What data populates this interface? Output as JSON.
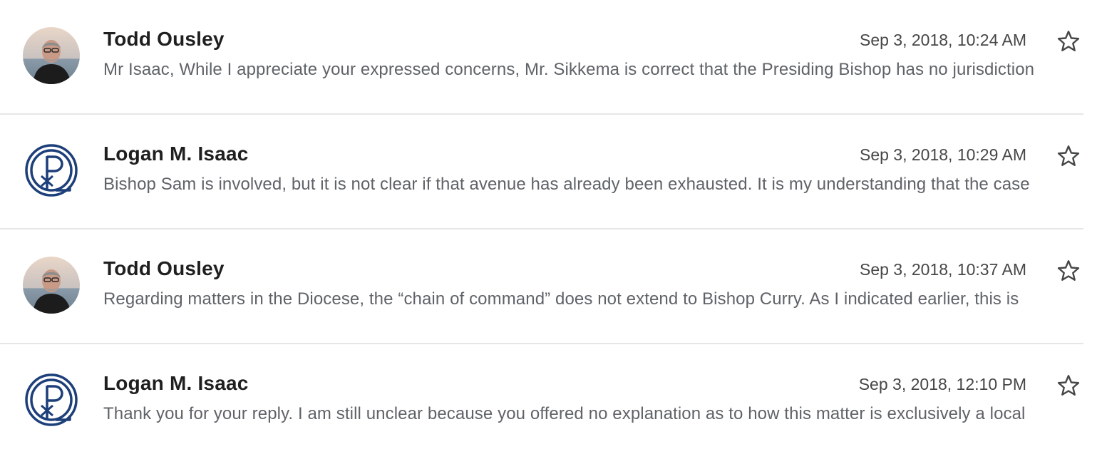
{
  "messages": [
    {
      "sender": "Todd Ousley",
      "avatar": "photo",
      "date": "Sep 3, 2018, 10:24 AM",
      "snippet": "Mr Isaac, While I appreciate your expressed concerns, Mr. Sikkema is correct that the Presiding Bishop has no jurisdiction",
      "starred": false
    },
    {
      "sender": "Logan M. Isaac",
      "avatar": "chi-rho-logo",
      "date": "Sep 3, 2018, 10:29 AM",
      "snippet": "Bishop Sam is involved, but it is not clear if that avenue has already been exhausted. It is my understanding that the case",
      "starred": false
    },
    {
      "sender": "Todd Ousley",
      "avatar": "photo",
      "date": "Sep 3, 2018, 10:37 AM",
      "snippet": "Regarding matters in the Diocese, the “chain of command” does not extend to Bishop Curry. As I indicated earlier, this is",
      "starred": false
    },
    {
      "sender": "Logan M. Isaac",
      "avatar": "chi-rho-logo",
      "date": "Sep 3, 2018, 12:10 PM",
      "snippet": "Thank you for your reply. I am still unclear because you offered no explanation as to how this matter is exclusively a local",
      "starred": false
    }
  ],
  "icons": {
    "star": "star-outline-icon"
  },
  "colors": {
    "logo_blue": "#1d3f7a",
    "divider": "#e6e6e6",
    "sender_text": "#1f1f1f",
    "snippet_text": "#5f6368"
  }
}
